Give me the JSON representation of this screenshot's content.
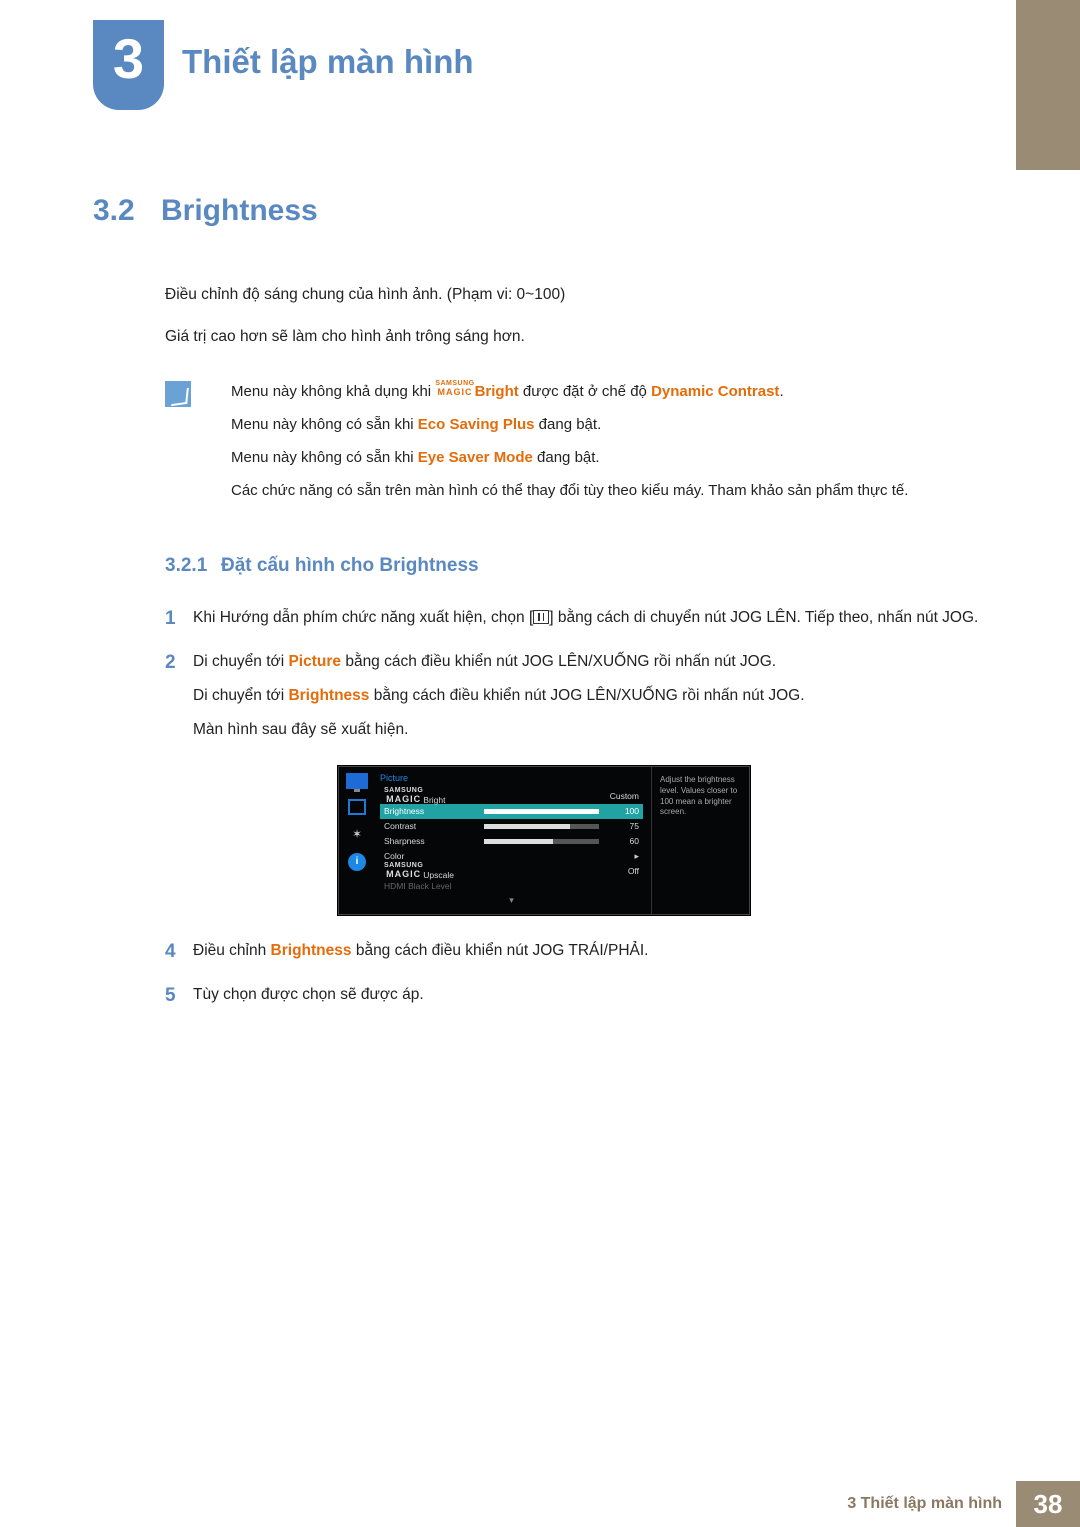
{
  "chapter": {
    "number": "3",
    "title": "Thiết lập màn hình"
  },
  "section": {
    "number": "3.2",
    "title": "Brightness",
    "intro1": "Điều chỉnh độ sáng chung của hình ảnh. (Phạm vi: 0~100)",
    "intro2": "Giá trị cao hơn sẽ làm cho hình ảnh trông sáng hơn."
  },
  "notes": {
    "line1a": "Menu này không khả dụng khi ",
    "line1b": "Bright",
    "line1c": " được đặt ở chế độ ",
    "line1d": "Dynamic Contrast",
    "line1e": ".",
    "line2a": "Menu này không có sẵn khi ",
    "line2b": "Eco Saving Plus",
    "line2c": " đang bật.",
    "line3a": "Menu này không có sẵn khi ",
    "line3b": "Eye Saver Mode",
    "line3c": " đang bật.",
    "line4": "Các chức năng có sẵn trên màn hình có thể thay đổi tùy theo kiểu máy. Tham khảo sản phẩm thực tế."
  },
  "subsection": {
    "number": "3.2.1",
    "title": "Đặt cấu hình cho Brightness"
  },
  "steps": {
    "s1": {
      "n": "1",
      "t1": "Khi Hướng dẫn phím chức năng xuất hiện, chọn [",
      "t2": "] bằng cách di chuyển nút JOG LÊN. Tiếp theo, nhấn nút JOG."
    },
    "s2": {
      "n": "2",
      "p1a": "Di chuyển tới ",
      "p1b": "Picture",
      "p1c": " bằng cách điều khiển nút JOG LÊN/XUỐNG rồi nhấn nút JOG.",
      "p2a": "Di chuyển tới ",
      "p2b": "Brightness",
      "p2c": " bằng cách điều khiển nút JOG LÊN/XUỐNG rồi nhấn nút JOG.",
      "p3": "Màn hình sau đây sẽ xuất hiện."
    },
    "s4": {
      "n": "4",
      "t1": "Điều chỉnh ",
      "t2": "Brightness",
      "t3": " bằng cách điều khiển nút JOG TRÁI/PHẢI."
    },
    "s5": {
      "n": "5",
      "t": "Tùy chọn được chọn sẽ được áp."
    }
  },
  "osd": {
    "title": "Picture",
    "rows": {
      "r0": {
        "label": "Bright",
        "value": "Custom"
      },
      "r1": {
        "label": "Brightness",
        "value": "100",
        "pct": 100
      },
      "r2": {
        "label": "Contrast",
        "value": "75",
        "pct": 75
      },
      "r3": {
        "label": "Sharpness",
        "value": "60",
        "pct": 60
      },
      "r4": {
        "label": "Color",
        "arrow": "▸"
      },
      "r5": {
        "label": "Upscale",
        "value": "Off"
      },
      "r6": {
        "label": "HDMI Black Level"
      }
    },
    "help": "Adjust the brightness level. Values closer to 100 mean a brighter screen.",
    "info_glyph": "i",
    "gear_glyph": "✶",
    "down_glyph": "▾"
  },
  "samsung_magic": {
    "top": "SAMSUNG",
    "bottom": "MAGIC"
  },
  "footer": {
    "chapter_label": "3 Thiết lập màn hình",
    "page": "38"
  }
}
